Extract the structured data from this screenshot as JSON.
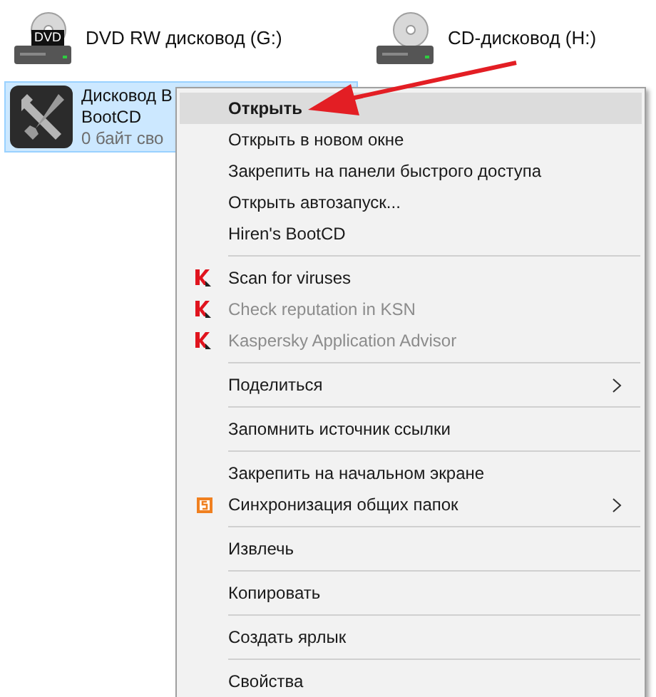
{
  "drives": [
    {
      "badge": "DVD",
      "label": "DVD RW дисковод (G:)"
    },
    {
      "label": "CD-дисковод (H:)"
    }
  ],
  "selected_drive": {
    "selected": true,
    "lines": [
      "Дисковод B",
      "BootCD",
      "0 байт сво"
    ]
  },
  "context_menu": {
    "groups": [
      [
        {
          "label": "Открыть",
          "kind": "default",
          "selected": true,
          "disabled": false
        },
        {
          "label": "Открыть в новом окне",
          "kind": "plain",
          "selected": false,
          "disabled": false
        },
        {
          "label": "Закрепить на панели быстрого доступа",
          "kind": "plain",
          "selected": false,
          "disabled": false
        },
        {
          "label": "Открыть автозапуск...",
          "kind": "plain",
          "selected": false,
          "disabled": false
        },
        {
          "label": "Hiren's BootCD",
          "kind": "plain",
          "selected": false,
          "disabled": false
        }
      ],
      [
        {
          "label": "Scan for viruses",
          "kind": "kaspersky",
          "selected": false,
          "disabled": false
        },
        {
          "label": "Check reputation in KSN",
          "kind": "kaspersky",
          "selected": false,
          "disabled": true
        },
        {
          "label": "Kaspersky Application Advisor",
          "kind": "kaspersky",
          "selected": false,
          "disabled": true
        }
      ],
      [
        {
          "label": "Поделиться",
          "kind": "submenu",
          "selected": false,
          "disabled": false
        }
      ],
      [
        {
          "label": "Запомнить источник ссылки",
          "kind": "plain",
          "selected": false,
          "disabled": false
        }
      ],
      [
        {
          "label": "Закрепить на начальном экране",
          "kind": "plain",
          "selected": false,
          "disabled": false
        },
        {
          "label": "Синхронизация общих папок",
          "kind": "sync",
          "selected": false,
          "disabled": false
        }
      ],
      [
        {
          "label": "Извлечь",
          "kind": "plain",
          "selected": false,
          "disabled": false
        }
      ],
      [
        {
          "label": "Копировать",
          "kind": "plain",
          "selected": false,
          "disabled": false
        }
      ],
      [
        {
          "label": "Создать ярлык",
          "kind": "plain",
          "selected": false,
          "disabled": false
        }
      ],
      [
        {
          "label": "Свойства",
          "kind": "plain",
          "selected": false,
          "disabled": false
        }
      ]
    ]
  }
}
